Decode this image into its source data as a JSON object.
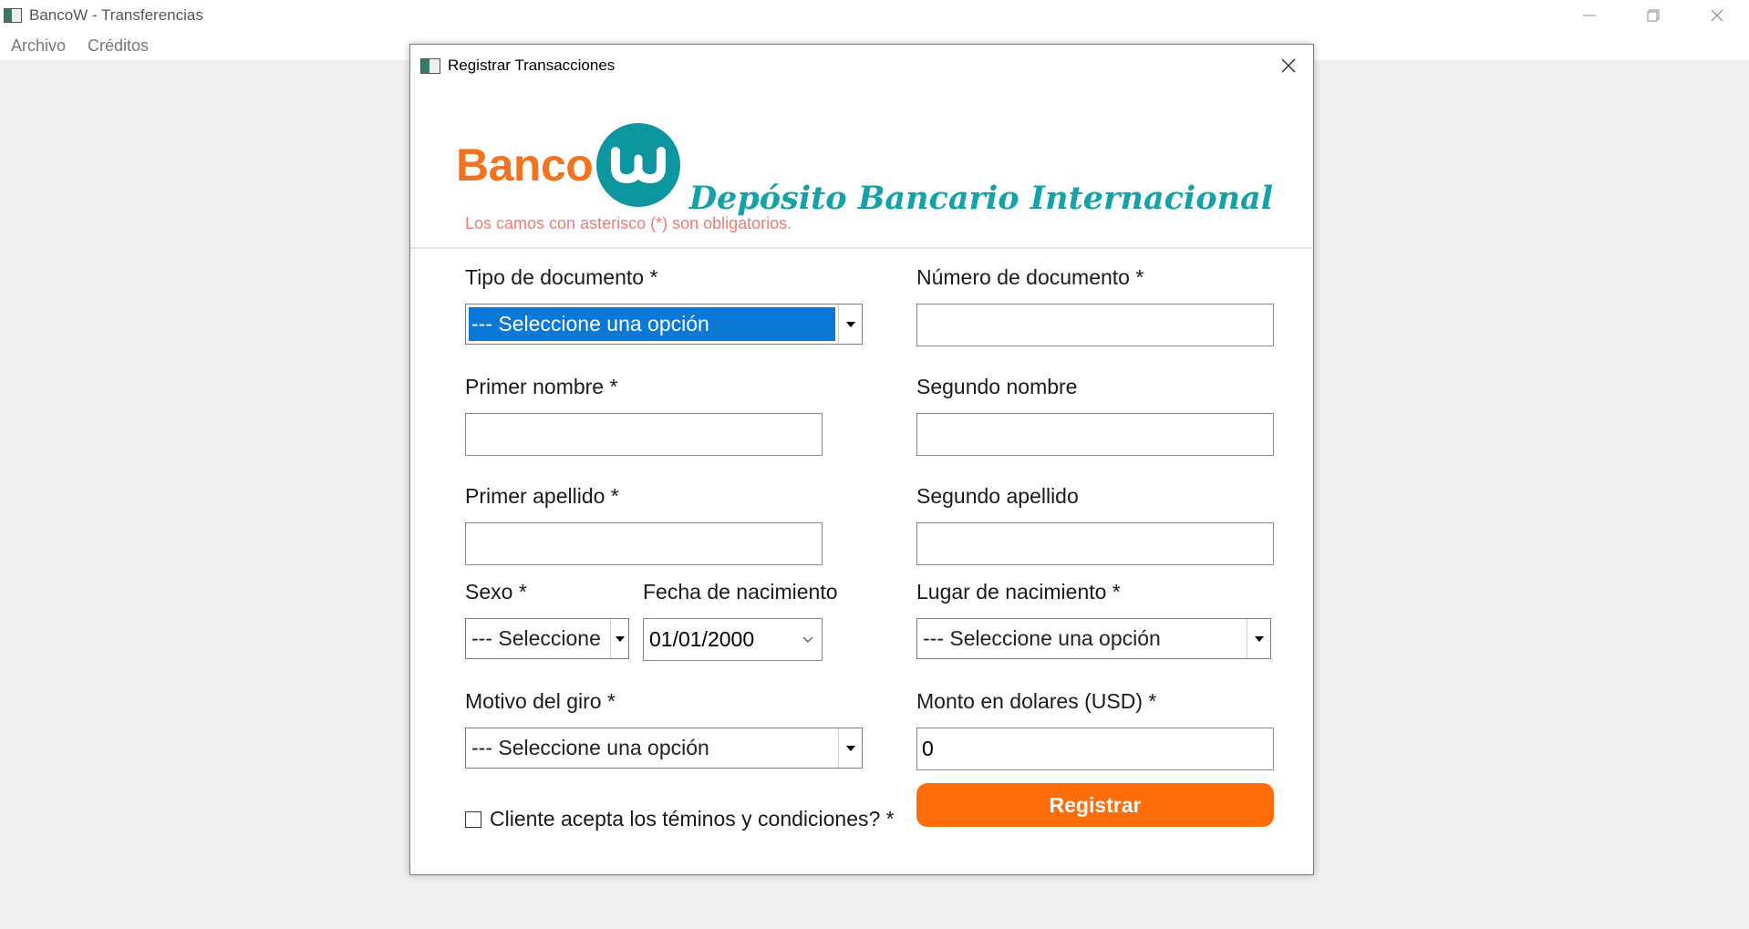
{
  "window": {
    "title": "BancoW - Transferencias"
  },
  "menu": {
    "items": [
      "Archivo",
      "Créditos"
    ]
  },
  "dialog": {
    "title": "Registrar Transacciones",
    "logo_text": "Banco",
    "headline": "Depósito Bancario Internacional",
    "required_note": "Los camos con asterisco (*) son obligatorios."
  },
  "form": {
    "tipo_documento": {
      "label": "Tipo de documento *",
      "value": "--- Seleccione una opción"
    },
    "numero_documento": {
      "label": "Número de documento *",
      "value": ""
    },
    "primer_nombre": {
      "label": "Primer nombre *",
      "value": ""
    },
    "segundo_nombre": {
      "label": "Segundo nombre",
      "value": ""
    },
    "primer_apellido": {
      "label": "Primer apellido *",
      "value": ""
    },
    "segundo_apellido": {
      "label": "Segundo apellido",
      "value": ""
    },
    "sexo": {
      "label": "Sexo *",
      "value": "--- Seleccione"
    },
    "fecha_nacimiento": {
      "label": "Fecha de nacimiento",
      "value": "01/01/2000"
    },
    "lugar_nacimiento": {
      "label": "Lugar de nacimiento *",
      "value": "--- Seleccione una opción"
    },
    "motivo_giro": {
      "label": "Motivo del giro *",
      "value": "--- Seleccione una opción"
    },
    "monto": {
      "label": "Monto en dolares (USD) *",
      "value": "0"
    },
    "terminos": {
      "label": "Cliente acepta los téminos y condiciones? *",
      "checked": false
    },
    "submit_label": "Registrar"
  },
  "colors": {
    "brand_orange": "#f47321",
    "brand_teal": "#0e96a0",
    "button_orange": "#ff6c0a",
    "selection_blue": "#0a78d7",
    "note_red": "#f07a7a"
  },
  "icons": {
    "app": "app-window-icon",
    "minimize": "minimize-icon",
    "restore": "restore-icon",
    "close": "close-icon",
    "dropdown": "dropdown-arrow-icon",
    "date": "chevron-down-icon"
  }
}
